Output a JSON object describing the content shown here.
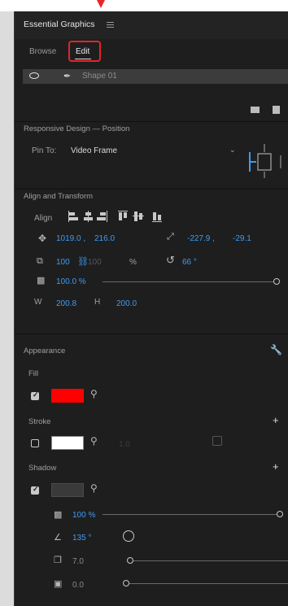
{
  "panel": {
    "title": "Essential Graphics",
    "tabs": [
      {
        "label": "Browse"
      },
      {
        "label": "Edit"
      }
    ]
  },
  "layer": {
    "name": "Shape 01"
  },
  "responsive": {
    "section": "Responsive Design — Position",
    "pin_label": "Pin To:",
    "pin_value": "Video Frame"
  },
  "align": {
    "section": "Align and Transform",
    "align_label": "Align",
    "position": {
      "x": "1019.0 ,",
      "y": "216.0"
    },
    "anchor": {
      "x": "-227.9 ,",
      "y": "-29.1"
    },
    "scale": {
      "w": "100",
      "h": "100",
      "unit": "%"
    },
    "rotation": "66 °",
    "opacity": "100.0 %",
    "size": {
      "w_label": "W",
      "w": "200.8",
      "h_label": "H",
      "h": "200.0"
    }
  },
  "appearance": {
    "section": "Appearance",
    "fill": {
      "label": "Fill",
      "color": "#ff0000"
    },
    "stroke": {
      "label": "Stroke",
      "color": "#ffffff",
      "value": "1.0"
    },
    "shadow": {
      "label": "Shadow",
      "color": "#3a3a3a",
      "opacity": "100 %",
      "angle": "135 °",
      "distance": "7.0",
      "size": "0.0"
    }
  },
  "colors": {
    "accent": "#3e9cf0",
    "highlight": "#e3252b"
  }
}
